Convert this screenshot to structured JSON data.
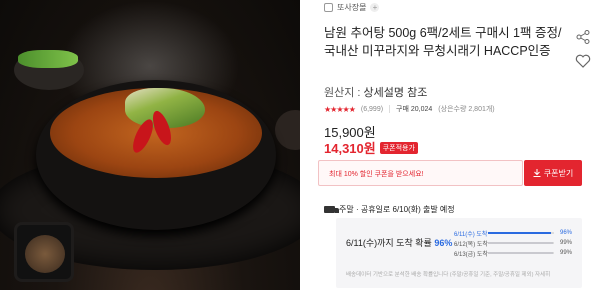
{
  "store": {
    "name": "또사장몰",
    "plus": "+"
  },
  "product": {
    "title": "남원 추어탕 500g 6팩/2세트 구매시 1팩 증정/국내산 미꾸라지와 무청시래기 HACCP인증",
    "origin_label": "원산지 :",
    "origin_value": "상세설명 참조",
    "review_count": "(6,999)",
    "sold_label": "구매 20,024",
    "sold_note": "(상은수량 2,801개)",
    "original_price": "15,900원",
    "sale_price": "14,310원",
    "coupon_applied": "쿠폰적용가"
  },
  "coupon": {
    "message": "최대 10% 할인 쿠폰을 받으세요!",
    "button_label": "쿠폰받기"
  },
  "shipping": {
    "headline": "주말 · 공휴일로 6/10(화) 출발 예정",
    "prob_label": "6/11(수)까지 도착 확률",
    "prob_value": "96%",
    "rows": [
      {
        "date": "6/11(수) 도착",
        "pct": "96%",
        "fraction": 0.96
      },
      {
        "date": "6/12(목) 도착",
        "pct": "99%",
        "fraction": 0.99
      },
      {
        "date": "6/13(금) 도착",
        "pct": "99%",
        "fraction": 0.99
      }
    ],
    "note": "배송데이터 기반으로 분석한 배송 확률입니다 (주말/공휴일 기준, 주말/공휴일 제외) 자세히"
  },
  "colors": {
    "accent": "#e3252f",
    "blue": "#2a6ae0"
  },
  "rating": {
    "stars": 4.5
  }
}
